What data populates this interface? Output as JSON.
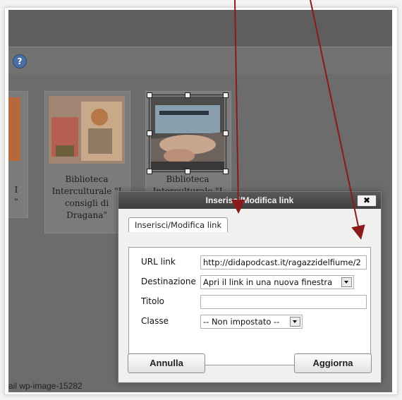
{
  "screenshot": {
    "help_icon": "question-icon",
    "gallery": {
      "left_caption_fragments": [
        "I",
        "\""
      ],
      "cards": [
        {
          "caption_lines": [
            "Biblioteca",
            "Interculturale \"I",
            "consigli di",
            "Dragana\""
          ]
        },
        {
          "caption_lines": [
            "Biblioteca",
            "Interculturale \"I"
          ]
        }
      ]
    },
    "status_text": "ail wp-image-15282"
  },
  "dialog": {
    "title": "Inserisci/Modifica link",
    "close_label": "✖",
    "tab_label": "Inserisci/Modifica link",
    "fields": {
      "url_label": "URL link",
      "url_value": "http://didapodcast.it/ragazzidelfiume/2",
      "target_label": "Destinazione",
      "target_value": "Apri il link in una nuova finestra",
      "title_label": "Titolo",
      "title_value": "",
      "class_label": "Classe",
      "class_value": "-- Non impostato --"
    },
    "cancel_label": "Annulla",
    "update_label": "Aggiorna"
  },
  "colors": {
    "arrow": "#8b1a1a",
    "overlay": "#6f6f6f",
    "dialog_title_bg": "#4a4a4a"
  }
}
